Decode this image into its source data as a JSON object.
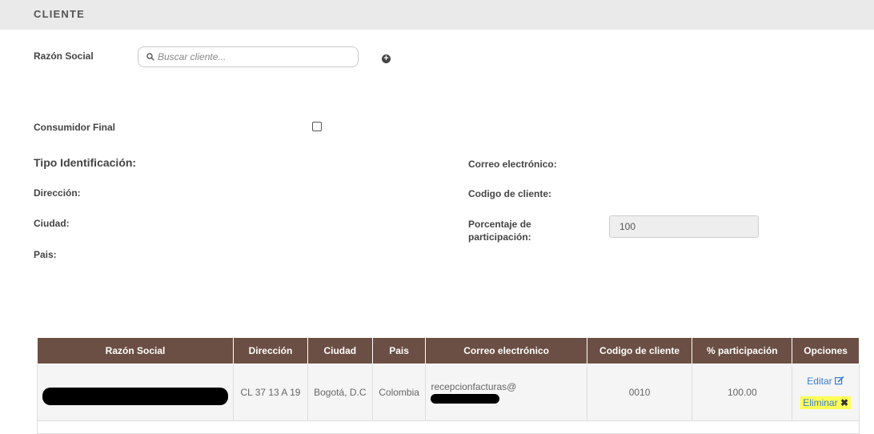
{
  "section": {
    "title": "CLIENTE"
  },
  "form": {
    "razon_social_label": "Razón Social",
    "search_placeholder": "Buscar cliente...",
    "consumidor_final_label": "Consumidor Final",
    "tipo_identificacion_label": "Tipo Identificación:",
    "direccion_label": "Dirección:",
    "ciudad_label": "Ciudad:",
    "pais_label": "Pais:",
    "correo_label": "Correo electrónico:",
    "codigo_label": "Codigo de cliente:",
    "porcentaje_label_1": "Porcentaje de",
    "porcentaje_label_2": "participación:",
    "porcentaje_value": "100"
  },
  "table": {
    "headers": [
      "Razón Social",
      "Dirección",
      "Ciudad",
      "Pais",
      "Correo electrónico",
      "Codigo de cliente",
      "% participación",
      "Opciones"
    ],
    "rows": [
      {
        "direccion": "CL 37 13 A 19",
        "ciudad": "Bogotá, D.C",
        "pais": "Colombia",
        "correo": "recepcionfacturas@",
        "codigo": "0010",
        "participacion": "100.00",
        "edit_label": "Editar",
        "delete_label": "Eliminar"
      }
    ]
  },
  "icons": {
    "search": "search-icon",
    "add": "plus-circle-icon",
    "edit": "edit-icon",
    "delete": "close-icon"
  },
  "colors": {
    "table_header": "#6b4f44",
    "link": "#3a7bd5",
    "highlight": "#ffff55"
  }
}
